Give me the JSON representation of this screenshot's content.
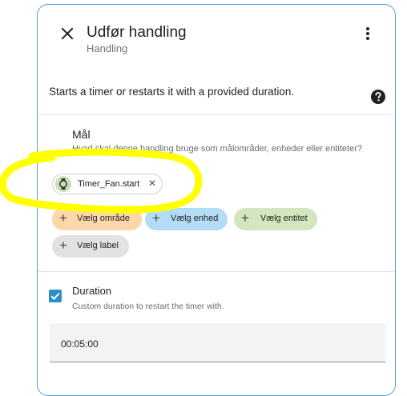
{
  "dialog": {
    "title": "Udfør handling",
    "subtitle": "Handling",
    "description": "Starts a timer or restarts it with a provided duration."
  },
  "target": {
    "title": "Mål",
    "subtitle": "Hvad skal denne handling bruge som målområder, enheder eller entiteter?",
    "selected_entity": "Timer_Fan.start",
    "buttons": {
      "area": "Vælg område",
      "device": "Vælg enhed",
      "entity": "Vælg entitet",
      "label": "Vælg label"
    }
  },
  "duration": {
    "title": "Duration",
    "subtitle": "Custom duration to restart the timer with.",
    "value": "00:05:00",
    "enabled": true
  },
  "colors": {
    "accent": "#2c8fc9",
    "area_chip": "#fbd7a9",
    "device_chip": "#b3dcf7",
    "entity_chip": "#d2e7bf",
    "label_chip": "#e2e2e2",
    "highlight": "#ffff00"
  },
  "icons": {
    "close": "close-icon",
    "menu": "more-vertical-icon",
    "help": "help-circle-icon",
    "entity": "timer-icon",
    "add": "plus-icon",
    "checkbox": "check-icon"
  }
}
